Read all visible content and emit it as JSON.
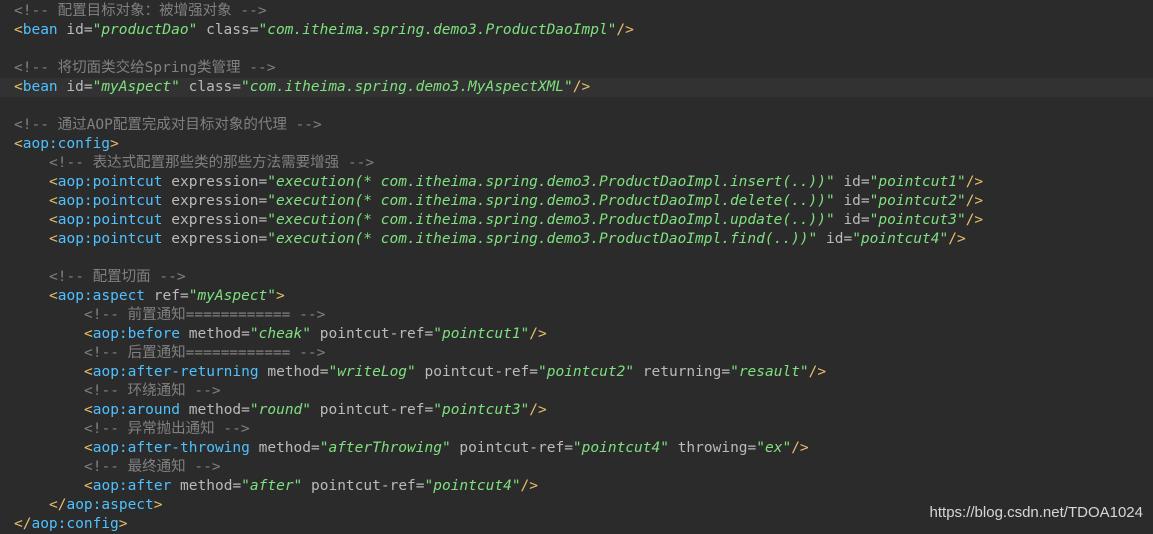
{
  "editor": {
    "lines": [
      {
        "indent": 1,
        "tokens": [
          {
            "t": "comment",
            "v": "<!-- 配置目标对象：被增强对象 -->"
          }
        ]
      },
      {
        "indent": 1,
        "tokens": [
          {
            "t": "bracket",
            "v": "<"
          },
          {
            "t": "name",
            "v": "bean"
          },
          {
            "t": "text",
            "v": " "
          },
          {
            "t": "attr",
            "v": "id"
          },
          {
            "t": "equal",
            "v": "="
          },
          {
            "t": "value-green",
            "v": "\"productDao\""
          },
          {
            "t": "text",
            "v": " "
          },
          {
            "t": "attr",
            "v": "class"
          },
          {
            "t": "equal",
            "v": "="
          },
          {
            "t": "value-green",
            "v": "\"com.itheima.spring.demo3.ProductDaoImpl\""
          },
          {
            "t": "bracket",
            "v": "/>"
          }
        ]
      },
      {
        "indent": 1,
        "tokens": []
      },
      {
        "indent": 1,
        "tokens": [
          {
            "t": "comment",
            "v": "<!-- 将切面类交给Spring类管理 -->"
          }
        ]
      },
      {
        "indent": 1,
        "current": true,
        "tokens": [
          {
            "t": "bracket",
            "v": "<"
          },
          {
            "t": "name",
            "v": "bean"
          },
          {
            "t": "text",
            "v": " "
          },
          {
            "t": "attr",
            "v": "id"
          },
          {
            "t": "equal",
            "v": "="
          },
          {
            "t": "value-green",
            "v": "\"myAspect\""
          },
          {
            "t": "text",
            "v": " "
          },
          {
            "t": "attr",
            "v": "class"
          },
          {
            "t": "equal",
            "v": "="
          },
          {
            "t": "value-green",
            "v": "\"com.itheima.spring.demo3.MyAspectXML\""
          },
          {
            "t": "bracket",
            "v": "/>"
          }
        ]
      },
      {
        "indent": 1,
        "tokens": []
      },
      {
        "indent": 1,
        "tokens": [
          {
            "t": "comment",
            "v": "<!-- 通过AOP配置完成对目标对象的代理 -->"
          }
        ]
      },
      {
        "indent": 1,
        "tokens": [
          {
            "t": "bracket",
            "v": "<"
          },
          {
            "t": "name",
            "v": "aop:config"
          },
          {
            "t": "bracket",
            "v": ">"
          }
        ]
      },
      {
        "indent": 5,
        "tokens": [
          {
            "t": "comment",
            "v": "<!-- 表达式配置那些类的那些方法需要增强 -->"
          }
        ]
      },
      {
        "indent": 5,
        "tokens": [
          {
            "t": "bracket",
            "v": "<"
          },
          {
            "t": "name",
            "v": "aop:pointcut"
          },
          {
            "t": "text",
            "v": " "
          },
          {
            "t": "attr",
            "v": "expression"
          },
          {
            "t": "equal",
            "v": "="
          },
          {
            "t": "value-green",
            "v": "\"execution(* com.itheima.spring.demo3.ProductDaoImpl.insert(..))\""
          },
          {
            "t": "text",
            "v": " "
          },
          {
            "t": "attr",
            "v": "id"
          },
          {
            "t": "equal",
            "v": "="
          },
          {
            "t": "value-green",
            "v": "\"pointcut1\""
          },
          {
            "t": "bracket",
            "v": "/>"
          }
        ]
      },
      {
        "indent": 5,
        "tokens": [
          {
            "t": "bracket",
            "v": "<"
          },
          {
            "t": "name",
            "v": "aop:pointcut"
          },
          {
            "t": "text",
            "v": " "
          },
          {
            "t": "attr",
            "v": "expression"
          },
          {
            "t": "equal",
            "v": "="
          },
          {
            "t": "value-green",
            "v": "\"execution(* com.itheima.spring.demo3.ProductDaoImpl.delete(..))\""
          },
          {
            "t": "text",
            "v": " "
          },
          {
            "t": "attr",
            "v": "id"
          },
          {
            "t": "equal",
            "v": "="
          },
          {
            "t": "value-green",
            "v": "\"pointcut2\""
          },
          {
            "t": "bracket",
            "v": "/>"
          }
        ]
      },
      {
        "indent": 5,
        "tokens": [
          {
            "t": "bracket",
            "v": "<"
          },
          {
            "t": "name",
            "v": "aop:pointcut"
          },
          {
            "t": "text",
            "v": " "
          },
          {
            "t": "attr",
            "v": "expression"
          },
          {
            "t": "equal",
            "v": "="
          },
          {
            "t": "value-green",
            "v": "\"execution(* com.itheima.spring.demo3.ProductDaoImpl.update(..))\""
          },
          {
            "t": "text",
            "v": " "
          },
          {
            "t": "attr",
            "v": "id"
          },
          {
            "t": "equal",
            "v": "="
          },
          {
            "t": "value-green",
            "v": "\"pointcut3\""
          },
          {
            "t": "bracket",
            "v": "/>"
          }
        ]
      },
      {
        "indent": 5,
        "tokens": [
          {
            "t": "bracket",
            "v": "<"
          },
          {
            "t": "name",
            "v": "aop:pointcut"
          },
          {
            "t": "text",
            "v": " "
          },
          {
            "t": "attr",
            "v": "expression"
          },
          {
            "t": "equal",
            "v": "="
          },
          {
            "t": "value-green",
            "v": "\"execution(* com.itheima.spring.demo3.ProductDaoImpl.find(..))\""
          },
          {
            "t": "text",
            "v": " "
          },
          {
            "t": "attr",
            "v": "id"
          },
          {
            "t": "equal",
            "v": "="
          },
          {
            "t": "value-green",
            "v": "\"pointcut4\""
          },
          {
            "t": "bracket",
            "v": "/>"
          }
        ]
      },
      {
        "indent": 5,
        "tokens": []
      },
      {
        "indent": 5,
        "tokens": [
          {
            "t": "comment",
            "v": "<!-- 配置切面 -->"
          }
        ]
      },
      {
        "indent": 5,
        "tokens": [
          {
            "t": "bracket",
            "v": "<"
          },
          {
            "t": "name",
            "v": "aop:aspect"
          },
          {
            "t": "text",
            "v": " "
          },
          {
            "t": "attr",
            "v": "ref"
          },
          {
            "t": "equal",
            "v": "="
          },
          {
            "t": "value-green",
            "v": "\"myAspect\""
          },
          {
            "t": "bracket",
            "v": ">"
          }
        ]
      },
      {
        "indent": 9,
        "tokens": [
          {
            "t": "comment",
            "v": "<!-- 前置通知============ -->"
          }
        ]
      },
      {
        "indent": 9,
        "tokens": [
          {
            "t": "bracket",
            "v": "<"
          },
          {
            "t": "name",
            "v": "aop:before"
          },
          {
            "t": "text",
            "v": " "
          },
          {
            "t": "attr",
            "v": "method"
          },
          {
            "t": "equal",
            "v": "="
          },
          {
            "t": "value-green",
            "v": "\"cheak\""
          },
          {
            "t": "text",
            "v": " "
          },
          {
            "t": "attr",
            "v": "pointcut-ref"
          },
          {
            "t": "equal",
            "v": "="
          },
          {
            "t": "value-green",
            "v": "\"pointcut1\""
          },
          {
            "t": "bracket",
            "v": "/>"
          }
        ]
      },
      {
        "indent": 9,
        "tokens": [
          {
            "t": "comment",
            "v": "<!-- 后置通知============ -->"
          }
        ]
      },
      {
        "indent": 9,
        "tokens": [
          {
            "t": "bracket",
            "v": "<"
          },
          {
            "t": "name",
            "v": "aop:after-returning"
          },
          {
            "t": "text",
            "v": " "
          },
          {
            "t": "attr",
            "v": "method"
          },
          {
            "t": "equal",
            "v": "="
          },
          {
            "t": "value-green",
            "v": "\"writeLog\""
          },
          {
            "t": "text",
            "v": " "
          },
          {
            "t": "attr",
            "v": "pointcut-ref"
          },
          {
            "t": "equal",
            "v": "="
          },
          {
            "t": "value-green",
            "v": "\"pointcut2\""
          },
          {
            "t": "text",
            "v": " "
          },
          {
            "t": "attr",
            "v": "returning"
          },
          {
            "t": "equal",
            "v": "="
          },
          {
            "t": "value-green",
            "v": "\"resault\""
          },
          {
            "t": "bracket",
            "v": "/>"
          }
        ]
      },
      {
        "indent": 9,
        "tokens": [
          {
            "t": "comment",
            "v": "<!-- 环绕通知 -->"
          }
        ]
      },
      {
        "indent": 9,
        "tokens": [
          {
            "t": "bracket",
            "v": "<"
          },
          {
            "t": "name",
            "v": "aop:around"
          },
          {
            "t": "text",
            "v": " "
          },
          {
            "t": "attr",
            "v": "method"
          },
          {
            "t": "equal",
            "v": "="
          },
          {
            "t": "value-green",
            "v": "\"round\""
          },
          {
            "t": "text",
            "v": " "
          },
          {
            "t": "attr",
            "v": "pointcut-ref"
          },
          {
            "t": "equal",
            "v": "="
          },
          {
            "t": "value-green",
            "v": "\"pointcut3\""
          },
          {
            "t": "bracket",
            "v": "/>"
          }
        ]
      },
      {
        "indent": 9,
        "tokens": [
          {
            "t": "comment",
            "v": "<!-- 异常抛出通知 -->"
          }
        ]
      },
      {
        "indent": 9,
        "tokens": [
          {
            "t": "bracket",
            "v": "<"
          },
          {
            "t": "name",
            "v": "aop:after-throwing"
          },
          {
            "t": "text",
            "v": " "
          },
          {
            "t": "attr",
            "v": "method"
          },
          {
            "t": "equal",
            "v": "="
          },
          {
            "t": "value-green",
            "v": "\"afterThrowing\""
          },
          {
            "t": "text",
            "v": " "
          },
          {
            "t": "attr",
            "v": "pointcut-ref"
          },
          {
            "t": "equal",
            "v": "="
          },
          {
            "t": "value-green",
            "v": "\"pointcut4\""
          },
          {
            "t": "text",
            "v": " "
          },
          {
            "t": "attr",
            "v": "throwing"
          },
          {
            "t": "equal",
            "v": "="
          },
          {
            "t": "value-green",
            "v": "\"ex\""
          },
          {
            "t": "bracket",
            "v": "/>"
          }
        ]
      },
      {
        "indent": 9,
        "tokens": [
          {
            "t": "comment",
            "v": "<!-- 最终通知 -->"
          }
        ]
      },
      {
        "indent": 9,
        "tokens": [
          {
            "t": "bracket",
            "v": "<"
          },
          {
            "t": "name",
            "v": "aop:after"
          },
          {
            "t": "text",
            "v": " "
          },
          {
            "t": "attr",
            "v": "method"
          },
          {
            "t": "equal",
            "v": "="
          },
          {
            "t": "value-green",
            "v": "\"after\""
          },
          {
            "t": "text",
            "v": " "
          },
          {
            "t": "attr",
            "v": "pointcut-ref"
          },
          {
            "t": "equal",
            "v": "="
          },
          {
            "t": "value-green",
            "v": "\"pointcut4\""
          },
          {
            "t": "bracket",
            "v": "/>"
          }
        ]
      },
      {
        "indent": 5,
        "tokens": [
          {
            "t": "bracket",
            "v": "</"
          },
          {
            "t": "name",
            "v": "aop:aspect"
          },
          {
            "t": "bracket",
            "v": ">"
          }
        ]
      },
      {
        "indent": 1,
        "tokens": [
          {
            "t": "bracket",
            "v": "</"
          },
          {
            "t": "name",
            "v": "aop:config"
          },
          {
            "t": "bracket",
            "v": ">"
          }
        ]
      }
    ]
  },
  "watermark": "https://blog.csdn.net/TDOA1024",
  "colors": {
    "background": "#2b2b2b",
    "current_line": "#323232",
    "comment": "#808080",
    "tag_bracket": "#e8bf6a",
    "tag_name": "#4fc1ff",
    "attribute": "#bababa",
    "value": "#7ee07e"
  }
}
